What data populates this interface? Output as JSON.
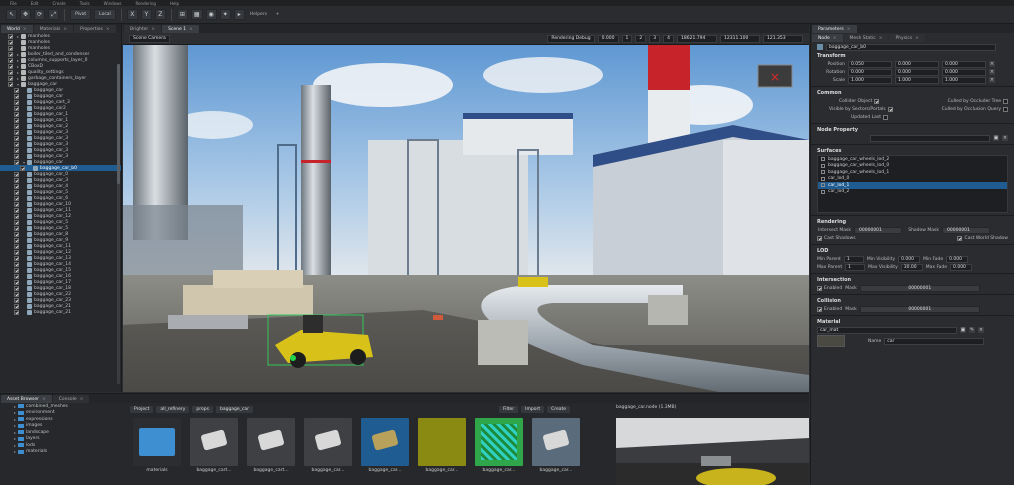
{
  "menu": [
    "File",
    "Edit",
    "Create",
    "Tools",
    "Windows",
    "Rendering",
    "Help"
  ],
  "toolbar": {
    "pivot": "Pivot",
    "local": "Local",
    "axes": [
      "X",
      "Y",
      "Z"
    ],
    "helpers": "Helpers"
  },
  "left_tabs": [
    {
      "label": "World",
      "active": true
    },
    {
      "label": "Materials",
      "active": false
    },
    {
      "label": "Properties",
      "active": false
    }
  ],
  "tree": [
    {
      "label": "manholes",
      "indent": 1,
      "checked": true,
      "expand": "+",
      "type": "n"
    },
    {
      "label": "manholes",
      "indent": 1,
      "checked": true,
      "expand": "",
      "type": "n"
    },
    {
      "label": "manholes",
      "indent": 1,
      "checked": true,
      "expand": "",
      "type": "n"
    },
    {
      "label": "boiler_tiled_and_condenser",
      "indent": 1,
      "checked": true,
      "expand": "+",
      "type": "n"
    },
    {
      "label": "columns_supports_layer_0",
      "indent": 1,
      "checked": true,
      "expand": "+",
      "type": "n"
    },
    {
      "label": "CBoxD",
      "indent": 1,
      "checked": true,
      "expand": "+",
      "type": "n"
    },
    {
      "label": "quality_settings",
      "indent": 1,
      "checked": true,
      "expand": "+",
      "type": "n"
    },
    {
      "label": "garbage_containers_layer",
      "indent": 1,
      "checked": true,
      "expand": "+",
      "type": "n"
    },
    {
      "label": "baggage_car",
      "indent": 1,
      "checked": true,
      "expand": "-",
      "type": "n"
    },
    {
      "label": "baggage_car",
      "indent": 2,
      "checked": true,
      "expand": "",
      "type": "m"
    },
    {
      "label": "baggage_car",
      "indent": 2,
      "checked": true,
      "expand": "",
      "type": "m"
    },
    {
      "label": "baggage_cart_3",
      "indent": 2,
      "checked": true,
      "expand": "",
      "type": "m"
    },
    {
      "label": "baggage_car2",
      "indent": 2,
      "checked": true,
      "expand": "",
      "type": "m"
    },
    {
      "label": "baggage_car_1",
      "indent": 2,
      "checked": true,
      "expand": "",
      "type": "m"
    },
    {
      "label": "baggage_car_1",
      "indent": 2,
      "checked": true,
      "expand": "",
      "type": "m"
    },
    {
      "label": "baggage_car_2",
      "indent": 2,
      "checked": true,
      "expand": "",
      "type": "m"
    },
    {
      "label": "baggage_car_3",
      "indent": 2,
      "checked": true,
      "expand": "",
      "type": "m"
    },
    {
      "label": "baggage_car_3",
      "indent": 2,
      "checked": true,
      "expand": "",
      "type": "m"
    },
    {
      "label": "baggage_car_3",
      "indent": 2,
      "checked": true,
      "expand": "",
      "type": "m"
    },
    {
      "label": "baggage_car_3",
      "indent": 2,
      "checked": true,
      "expand": "",
      "type": "m"
    },
    {
      "label": "baggage_car_3",
      "indent": 2,
      "checked": true,
      "expand": "",
      "type": "m"
    },
    {
      "label": "baggage_car",
      "indent": 2,
      "checked": true,
      "expand": "-",
      "type": "m"
    },
    {
      "label": "baggage_car_b0",
      "indent": 3,
      "checked": true,
      "expand": "",
      "type": "m",
      "selected": true
    },
    {
      "label": "baggage_car_0",
      "indent": 2,
      "checked": true,
      "expand": "",
      "type": "m"
    },
    {
      "label": "baggage_car_3",
      "indent": 2,
      "checked": true,
      "expand": "",
      "type": "m"
    },
    {
      "label": "baggage_car_4",
      "indent": 2,
      "checked": true,
      "expand": "",
      "type": "m"
    },
    {
      "label": "baggage_car_5",
      "indent": 2,
      "checked": true,
      "expand": "",
      "type": "m"
    },
    {
      "label": "baggage_car_6",
      "indent": 2,
      "checked": true,
      "expand": "",
      "type": "m"
    },
    {
      "label": "baggage_car_10",
      "indent": 2,
      "checked": true,
      "expand": "",
      "type": "m"
    },
    {
      "label": "baggage_car_11",
      "indent": 2,
      "checked": true,
      "expand": "",
      "type": "m"
    },
    {
      "label": "baggage_car_12",
      "indent": 2,
      "checked": true,
      "expand": "",
      "type": "m"
    },
    {
      "label": "baggage_car_5",
      "indent": 2,
      "checked": true,
      "expand": "",
      "type": "m"
    },
    {
      "label": "baggage_car_5",
      "indent": 2,
      "checked": true,
      "expand": "",
      "type": "m"
    },
    {
      "label": "baggage_car_8",
      "indent": 2,
      "checked": true,
      "expand": "",
      "type": "m"
    },
    {
      "label": "baggage_car_9",
      "indent": 2,
      "checked": true,
      "expand": "",
      "type": "m"
    },
    {
      "label": "baggage_car_11",
      "indent": 2,
      "checked": true,
      "expand": "",
      "type": "m"
    },
    {
      "label": "baggage_car_12",
      "indent": 2,
      "checked": true,
      "expand": "",
      "type": "m"
    },
    {
      "label": "baggage_car_13",
      "indent": 2,
      "checked": true,
      "expand": "",
      "type": "m"
    },
    {
      "label": "baggage_car_14",
      "indent": 2,
      "checked": true,
      "expand": "",
      "type": "m"
    },
    {
      "label": "baggage_car_15",
      "indent": 2,
      "checked": true,
      "expand": "",
      "type": "m"
    },
    {
      "label": "baggage_car_16",
      "indent": 2,
      "checked": true,
      "expand": "",
      "type": "m"
    },
    {
      "label": "baggage_car_17",
      "indent": 2,
      "checked": true,
      "expand": "",
      "type": "m"
    },
    {
      "label": "baggage_car_18",
      "indent": 2,
      "checked": true,
      "expand": "",
      "type": "m"
    },
    {
      "label": "baggage_car_22",
      "indent": 2,
      "checked": true,
      "expand": "",
      "type": "m"
    },
    {
      "label": "baggage_car_23",
      "indent": 2,
      "checked": true,
      "expand": "",
      "type": "m"
    },
    {
      "label": "baggage_car_21",
      "indent": 2,
      "checked": true,
      "expand": "",
      "type": "m"
    },
    {
      "label": "baggage_car_21",
      "indent": 2,
      "checked": true,
      "expand": "",
      "type": "m"
    }
  ],
  "viewport": {
    "tabs": [
      {
        "label": "Brighter",
        "active": false
      },
      {
        "label": "Scene 1",
        "active": true
      }
    ],
    "camera": "Scene Camera",
    "rendering": "Rendering Debug",
    "fov": "0.000",
    "coords": [
      "18621.794",
      "12311.100",
      "121.353"
    ],
    "pages": [
      "1",
      "2",
      "3",
      "4"
    ]
  },
  "right": {
    "tabs": [
      {
        "label": "Parameters",
        "active": true
      }
    ],
    "subtabs": [
      {
        "label": "Node",
        "active": true
      },
      {
        "label": "Mesh Static",
        "active": false
      },
      {
        "label": "Physics",
        "active": false
      }
    ],
    "node_name": "baggage_car_b0",
    "transform": {
      "title": "Transform",
      "position": {
        "label": "Position",
        "x": "0.050",
        "y": "0.000",
        "z": "0.000"
      },
      "rotation": {
        "label": "Rotation",
        "x": "0.000",
        "y": "0.000",
        "z": "0.000"
      },
      "scale": {
        "label": "Scale",
        "x": "1.000",
        "y": "1.000",
        "z": "1.000"
      }
    },
    "common": {
      "title": "Common",
      "collider": "Collider Object",
      "culled_occluder": "Culled by Occluder Tree",
      "visible_sectors": "Visible by Sectors/Portals",
      "culled_query": "Culled by Occlusion Query",
      "updated_last": "Updated Last"
    },
    "node_property": "Node Property",
    "surfaces": {
      "title": "Surfaces",
      "items": [
        {
          "label": "baggage_car_wheels_lod_2",
          "sel": false
        },
        {
          "label": "baggage_car_wheels_lod_0",
          "sel": false
        },
        {
          "label": "baggage_car_wheels_lod_1",
          "sel": false
        },
        {
          "label": "car_lod_0",
          "sel": false
        },
        {
          "label": "car_lod_1",
          "sel": true
        },
        {
          "label": "car_lod_2",
          "sel": false
        }
      ]
    },
    "rendering": {
      "title": "Rendering",
      "intersect_mask_label": "Intersect Mask",
      "intersect_mask": "00000001",
      "shadow_mask_label": "Shadow Mask",
      "shadow_mask": "00000001",
      "cast_shadows": "Cast Shadows",
      "cast_world_shadow": "Cast World Shadow"
    },
    "lod": {
      "title": "LOD",
      "min_parent_label": "Min Parent",
      "min_parent": "1",
      "min_visibility_label": "Min Visibility",
      "min_visibility": "0.000",
      "min_fade_label": "Min Fade",
      "min_fade": "0.000",
      "max_parent_label": "Max Parent",
      "max_parent": "1",
      "max_visibility_label": "Max Visibility",
      "max_visibility": "30.00",
      "max_fade_label": "Max Fade",
      "max_fade": "0.000"
    },
    "intersection": {
      "title": "Intersection",
      "enabled": "Enabled",
      "mask_label": "Mask",
      "mask": "00000001"
    },
    "collision": {
      "title": "Collision",
      "enabled": "Enabled",
      "mask_label": "Mask",
      "mask": "00000001"
    },
    "material": {
      "title": "Material",
      "value": "car_mat",
      "name_label": "Name",
      "name": "car"
    }
  },
  "bottom": {
    "tabs": [
      {
        "label": "Asset Browser",
        "active": true
      },
      {
        "label": "Console",
        "active": false
      }
    ],
    "tree": [
      {
        "label": "combined_meshes",
        "indent": 1
      },
      {
        "label": "environment",
        "indent": 1
      },
      {
        "label": "expressions",
        "indent": 1
      },
      {
        "label": "images",
        "indent": 1
      },
      {
        "label": "landscape",
        "indent": 1
      },
      {
        "label": "layers",
        "indent": 1
      },
      {
        "label": "lods",
        "indent": 1
      },
      {
        "label": "materials",
        "indent": 1
      }
    ],
    "breadcrumb": [
      "Project",
      "all_refinery",
      "props",
      "baggage_car"
    ],
    "filter": "Filter",
    "import": "Import",
    "create": "Create",
    "preview_title": "baggage_car.node (1.3MB)",
    "thumbs": [
      {
        "label": "materials",
        "kind": "folder"
      },
      {
        "label": "baggage_cart...",
        "kind": "mesh1"
      },
      {
        "label": "baggage_cart...",
        "kind": "mesh2"
      },
      {
        "label": "baggage_car...",
        "kind": "mesh3"
      },
      {
        "label": "baggage_car...",
        "kind": "sel"
      },
      {
        "label": "baggage_car...",
        "kind": "olive"
      },
      {
        "label": "baggage_car...",
        "kind": "normal"
      },
      {
        "label": "baggage_car...",
        "kind": "tex"
      }
    ]
  },
  "colors": {
    "accent": "#1f5c92",
    "sky": "#7fb2e0",
    "folder": "#3d8fd1",
    "olive": "#8a8a12"
  }
}
